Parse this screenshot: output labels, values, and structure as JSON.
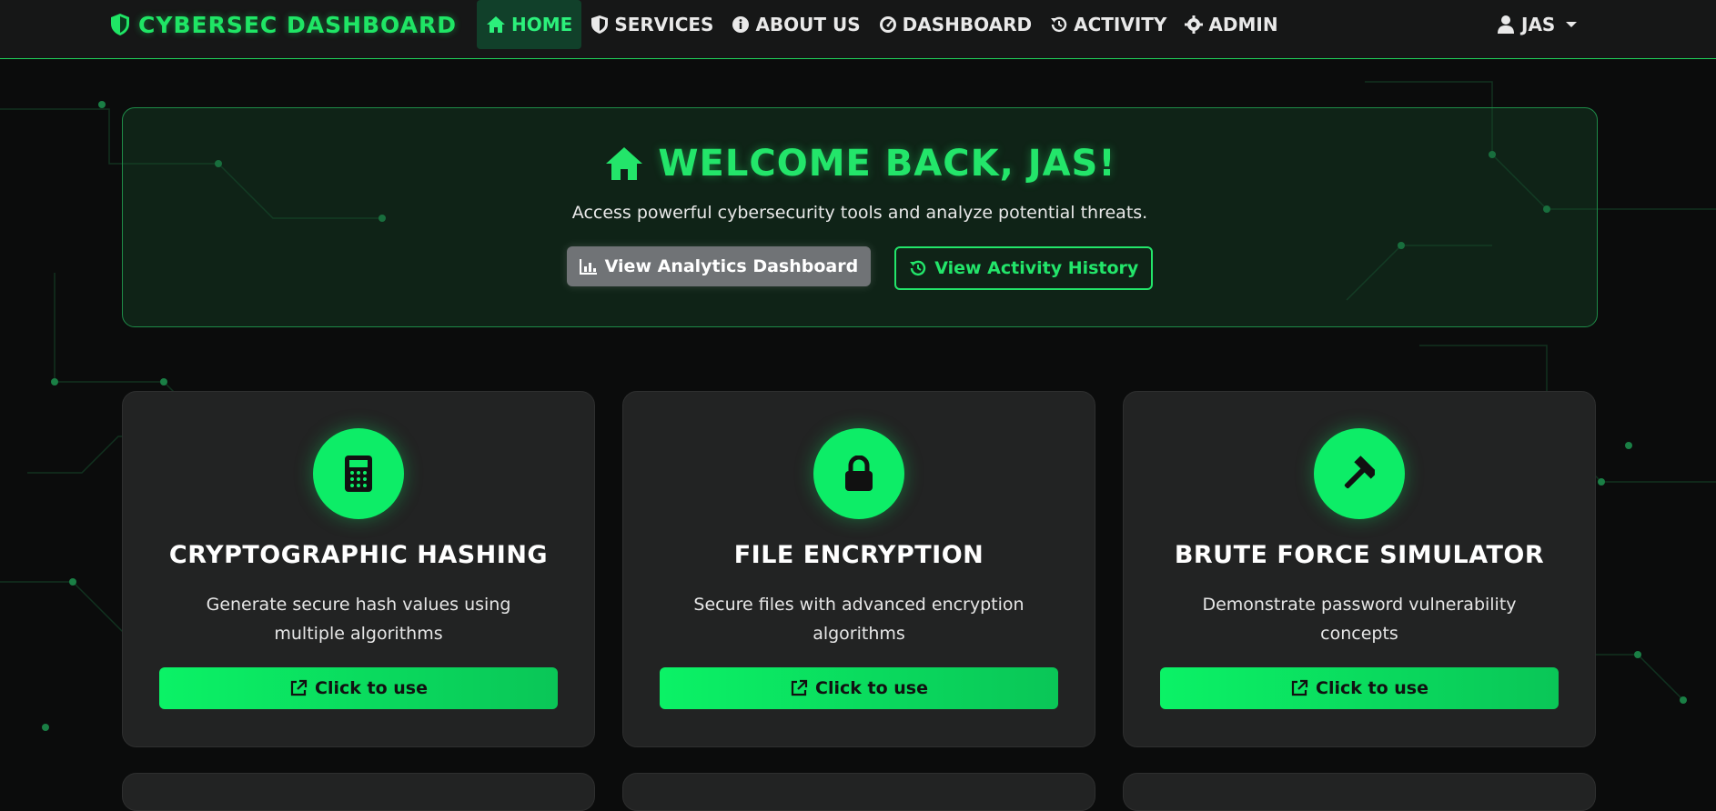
{
  "nav": {
    "brand": "CYBERSEC DASHBOARD",
    "items": [
      {
        "label": "HOME",
        "icon": "home-icon",
        "active": true
      },
      {
        "label": "SERVICES",
        "icon": "shield-icon"
      },
      {
        "label": "ABOUT US",
        "icon": "info-icon"
      },
      {
        "label": "DASHBOARD",
        "icon": "gauge-icon"
      },
      {
        "label": "ACTIVITY",
        "icon": "history-icon"
      },
      {
        "label": "ADMIN",
        "icon": "gear-icon"
      }
    ],
    "user": "JAS"
  },
  "hero": {
    "title": "WELCOME BACK, JAS!",
    "subtitle": "Access powerful cybersecurity tools and analyze potential threats.",
    "btn_analytics": "View Analytics Dashboard",
    "btn_activity": "View Activity History"
  },
  "cards": [
    {
      "title": "CRYPTOGRAPHIC HASHING",
      "desc": "Generate secure hash values using multiple algorithms",
      "btn": "Click to use",
      "icon": "calculator-icon"
    },
    {
      "title": "FILE ENCRYPTION",
      "desc": "Secure files with advanced encryption algorithms",
      "btn": "Click to use",
      "icon": "lock-icon"
    },
    {
      "title": "BRUTE FORCE SIMULATOR",
      "desc": "Demonstrate password vulnerability concepts",
      "btn": "Click to use",
      "icon": "hammer-icon"
    }
  ],
  "colors": {
    "accent": "#1fe565",
    "background": "#0b0c0c",
    "card": "#222323",
    "button_gray": "#707376"
  }
}
